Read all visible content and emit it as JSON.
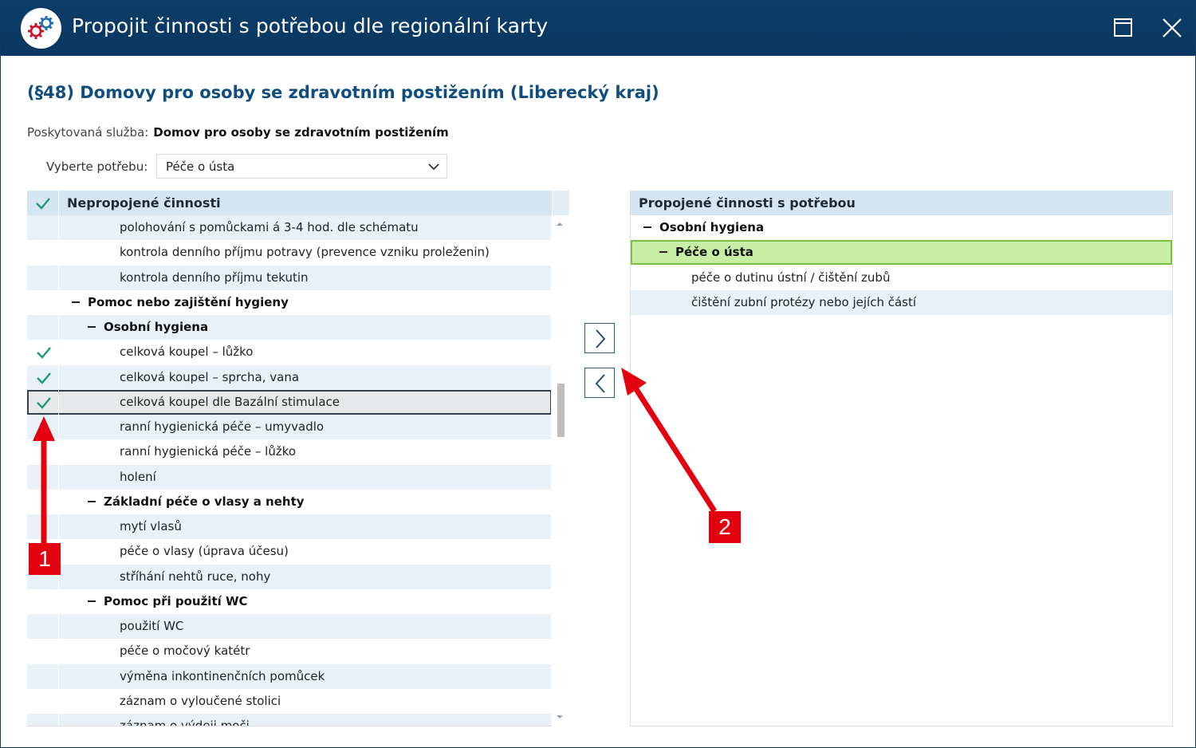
{
  "window": {
    "title": "Propojit činnosti s potřebou dle regionální karty",
    "icons": {
      "app": "gears-icon",
      "maximize": "maximize-icon",
      "close": "close-icon"
    }
  },
  "heading": "(§48) Domovy pro osoby se zdravotním postižením (Liberecký kraj)",
  "service": {
    "label": "Poskytovaná služba:",
    "value": "Domov pro osoby se zdravotním postižením"
  },
  "need_select": {
    "label": "Vyberte potřebu:",
    "value": "Péče o ústa"
  },
  "left_panel": {
    "title": "Nepropojené činnosti",
    "rows": [
      {
        "label": "polohování s pomůckami á 3-4 hod. dle schématu",
        "level": 2,
        "group": false,
        "checked": false
      },
      {
        "label": "kontrola denního příjmu potravy (prevence vzniku proleženin)",
        "level": 2,
        "group": false,
        "checked": false
      },
      {
        "label": "kontrola denního příjmu tekutin",
        "level": 2,
        "group": false,
        "checked": false
      },
      {
        "label": "Pomoc nebo zajištění hygieny",
        "level": 0,
        "group": true,
        "checked": false
      },
      {
        "label": "Osobní hygiena",
        "level": 1,
        "group": true,
        "checked": false
      },
      {
        "label": "celková koupel – lůžko",
        "level": 2,
        "group": false,
        "checked": true
      },
      {
        "label": "celková koupel – sprcha, vana",
        "level": 2,
        "group": false,
        "checked": true
      },
      {
        "label": "celková koupel dle Bazální stimulace",
        "level": 2,
        "group": false,
        "checked": true,
        "selected": true
      },
      {
        "label": "ranní hygienická péče – umyvadlo",
        "level": 2,
        "group": false,
        "checked": false
      },
      {
        "label": "ranní hygienická péče – lůžko",
        "level": 2,
        "group": false,
        "checked": false
      },
      {
        "label": "holení",
        "level": 2,
        "group": false,
        "checked": false
      },
      {
        "label": "Základní péče o vlasy a nehty",
        "level": 1,
        "group": true,
        "checked": false
      },
      {
        "label": "mytí vlasů",
        "level": 2,
        "group": false,
        "checked": false
      },
      {
        "label": "péče o vlasy (úprava účesu)",
        "level": 2,
        "group": false,
        "checked": false
      },
      {
        "label": "stříhání nehtů ruce, nohy",
        "level": 2,
        "group": false,
        "checked": false
      },
      {
        "label": "Pomoc při použití WC",
        "level": 1,
        "group": true,
        "checked": false
      },
      {
        "label": "použití WC",
        "level": 2,
        "group": false,
        "checked": false
      },
      {
        "label": "péče o močový katétr",
        "level": 2,
        "group": false,
        "checked": false
      },
      {
        "label": "výměna inkontinenčních pomůcek",
        "level": 2,
        "group": false,
        "checked": false
      },
      {
        "label": "záznam o vyloučené stolici",
        "level": 2,
        "group": false,
        "checked": false
      },
      {
        "label": "záznam o výdeji moči",
        "level": 2,
        "group": false,
        "checked": false
      }
    ]
  },
  "right_panel": {
    "title": "Propojené činnosti s potřebou",
    "rows": [
      {
        "label": "Osobní hygiena",
        "level": 0,
        "group": true,
        "highlight": false
      },
      {
        "label": "Péče o ústa",
        "level": 1,
        "group": true,
        "highlight": true
      },
      {
        "label": "péče o dutinu ústní / čištění zubů",
        "level": 2,
        "group": false,
        "highlight": false
      },
      {
        "label": "čištění zubní protézy nebo jejích částí",
        "level": 2,
        "group": false,
        "highlight": false
      }
    ]
  },
  "annotations": {
    "badge1": "1",
    "badge2": "2",
    "color": "#e3000f"
  },
  "colors": {
    "titlebar": "#0b3d68",
    "heading": "#0f4e7e",
    "check": "#1a9a78",
    "highlight": "#c6eea5"
  }
}
